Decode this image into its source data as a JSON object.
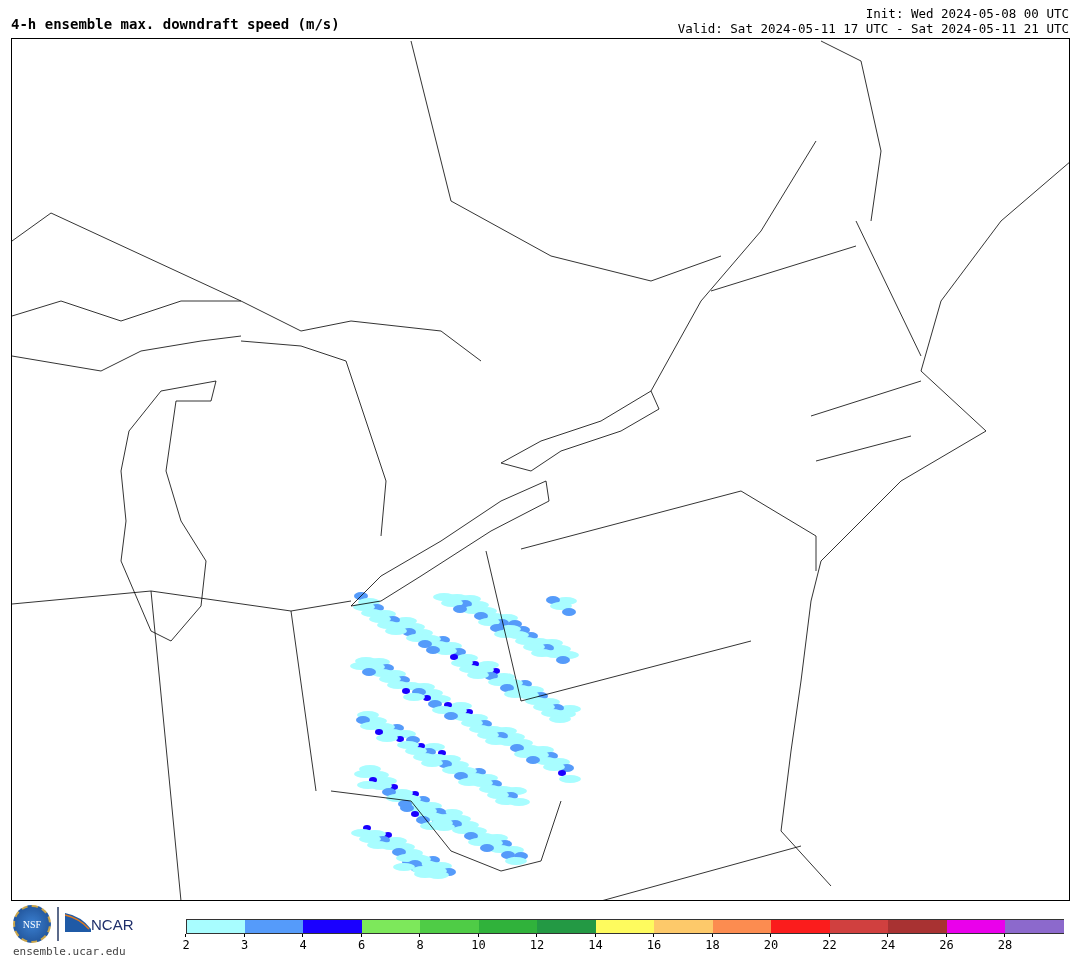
{
  "header": {
    "title": "4-h ensemble max. downdraft speed (m/s)",
    "init": "Init: Wed 2024-05-08 00 UTC",
    "valid": "Valid: Sat 2024-05-11 17 UTC - Sat 2024-05-11 21 UTC"
  },
  "footer": {
    "logo_nsf": "NSF",
    "logo_ncar": "NCAR",
    "site": "ensemble.ucar.edu"
  },
  "colorbar": {
    "bins": [
      {
        "color": "#a8fdff"
      },
      {
        "color": "#559bfa"
      },
      {
        "color": "#1a00ff"
      },
      {
        "color": "#7de85b"
      },
      {
        "color": "#4fcc46"
      },
      {
        "color": "#30b23b"
      },
      {
        "color": "#239944"
      },
      {
        "color": "#fefb5e"
      },
      {
        "color": "#fdc96a"
      },
      {
        "color": "#fc8c50"
      },
      {
        "color": "#fb1c1c"
      },
      {
        "color": "#d0403f"
      },
      {
        "color": "#a83232"
      },
      {
        "color": "#ea00eb"
      },
      {
        "color": "#8c69cc"
      }
    ],
    "ticks": [
      "2",
      "3",
      "4",
      "6",
      "8",
      "10",
      "12",
      "14",
      "16",
      "18",
      "20",
      "22",
      "24",
      "26",
      "28"
    ]
  }
}
